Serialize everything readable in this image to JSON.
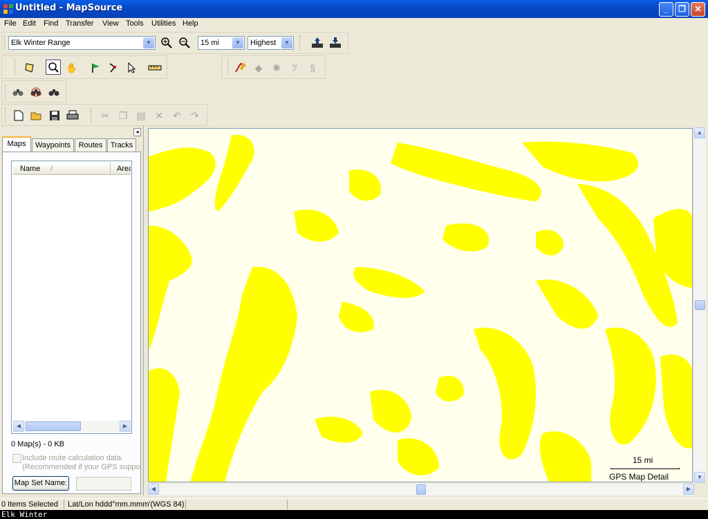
{
  "window": {
    "title": "Untitled - MapSource",
    "minimize": "_",
    "maximize": "❐",
    "close": "✕"
  },
  "menu": [
    "File",
    "Edit",
    "Find",
    "Transfer",
    "View",
    "Tools",
    "Utilities",
    "Help"
  ],
  "toolbar": {
    "map_product": "Elk Winter Range",
    "zoom_scale": "15 mi",
    "detail_level": "Highest"
  },
  "tabs": [
    "Maps",
    "Waypoints",
    "Routes",
    "Tracks"
  ],
  "maps_panel": {
    "col_name": "Name",
    "sort_marker": "/",
    "col_area": "Area",
    "summary": "0 Map(s) - 0 KB",
    "include_route_label": "Include route calculation data.",
    "recommended_note": "(Recommended if your GPS support",
    "map_set_button": "Map Set Name:",
    "map_set_value": ""
  },
  "map": {
    "scale_label": "15 mi",
    "detail_label": "GPS Map Detail",
    "fill_color": "#ffff00",
    "background_color": "#ffffec"
  },
  "status": {
    "selected": "0 Items Selected",
    "position_format": "Lat/Lon hddd°mm.mmm'(WGS 84)"
  },
  "console": "Elk Winter"
}
